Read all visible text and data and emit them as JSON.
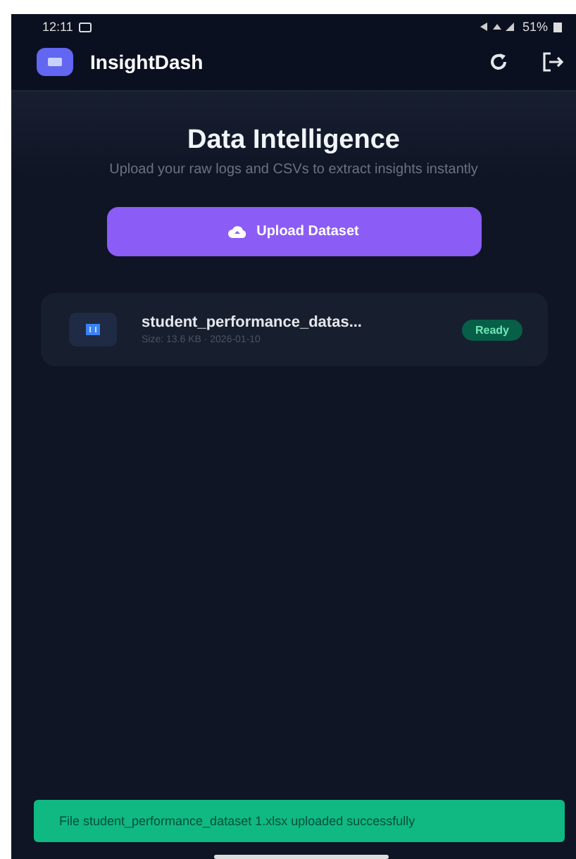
{
  "status_bar": {
    "time": "12:11",
    "battery": "51%"
  },
  "header": {
    "title": "InsightDash"
  },
  "hero": {
    "title": "Data Intelligence",
    "subtitle": "Upload your raw logs and CSVs to extract insights instantly",
    "button": "Upload Dataset"
  },
  "files": [
    {
      "name": "student_performance_datas...",
      "meta": "Size: 13.6 KB · 2026-01-10",
      "status": "Ready",
      "color": "#065f46"
    }
  ],
  "toast": {
    "message": "File student_performance_dataset 1.xlsx uploaded successfully"
  }
}
